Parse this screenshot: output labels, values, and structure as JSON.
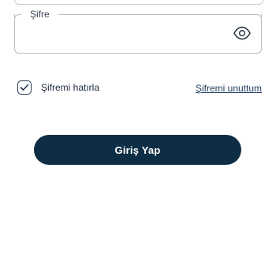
{
  "password_field": {
    "label": "Şifre"
  },
  "remember": {
    "label": "Şifremi hatırla",
    "checked": true
  },
  "forgot_link": {
    "label": "Şifremi unuttum"
  },
  "login_button": {
    "label": "Giriş Yap"
  },
  "colors": {
    "primary": "#0d2e45",
    "border": "#b9bfc7"
  },
  "icons": {
    "visibility": "eye-icon",
    "check": "check-icon"
  }
}
